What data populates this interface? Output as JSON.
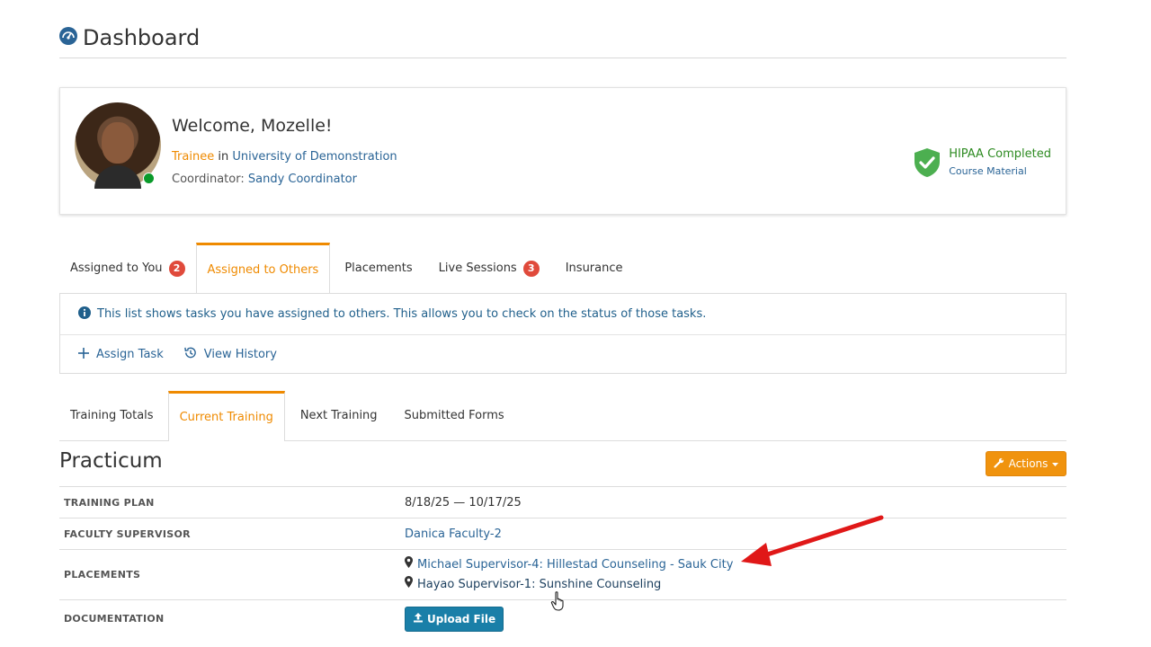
{
  "page": {
    "title": "Dashboard"
  },
  "welcome": {
    "heading": "Welcome, Mozelle!",
    "role": "Trainee",
    "in_word": "in",
    "organization": "University of Demonstration",
    "coordinator_label": "Coordinator:",
    "coordinator_name": "Sandy Coordinator",
    "hipaa_title": "HIPAA Completed",
    "hipaa_link": "Course Material"
  },
  "task_tabs": [
    {
      "label": "Assigned to You",
      "badge": "2"
    },
    {
      "label": "Assigned to Others"
    },
    {
      "label": "Placements"
    },
    {
      "label": "Live Sessions",
      "badge": "3"
    },
    {
      "label": "Insurance"
    }
  ],
  "task_panel": {
    "info_text": "This list shows tasks you have assigned to others. This allows you to check on the status of those tasks.",
    "assign_task": "Assign Task",
    "view_history": "View History"
  },
  "training_tabs": [
    {
      "label": "Training Totals"
    },
    {
      "label": "Current Training"
    },
    {
      "label": "Next Training"
    },
    {
      "label": "Submitted Forms"
    }
  ],
  "training": {
    "section_title": "Practicum",
    "actions_label": "Actions",
    "rows": {
      "plan_label": "TRAINING PLAN",
      "plan_value": "8/18/25 — 10/17/25",
      "supervisor_label": "FACULTY SUPERVISOR",
      "supervisor_value": "Danica Faculty-2",
      "placements_label": "PLACEMENTS",
      "placement_1": "Michael Supervisor-4: Hillestad Counseling - Sauk City",
      "placement_2": "Hayao Supervisor-1: Sunshine Counseling",
      "documentation_label": "DOCUMENTATION",
      "upload_label": "Upload File"
    }
  },
  "colors": {
    "accent_orange": "#ef8a00",
    "link_blue": "#2a6496",
    "badge_red": "#e04a3b",
    "hipaa_green": "#2e8b22",
    "annotation_red": "#e01818"
  }
}
